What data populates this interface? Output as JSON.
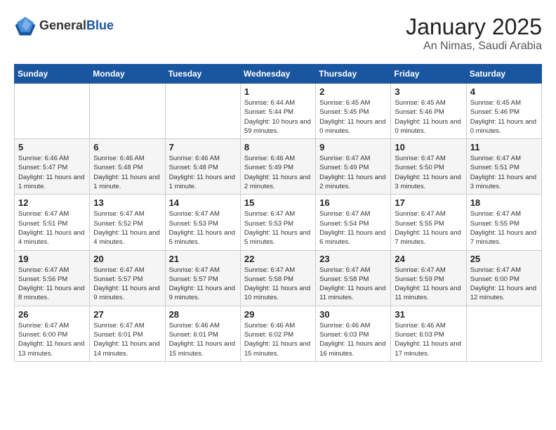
{
  "header": {
    "logo_general": "General",
    "logo_blue": "Blue",
    "month": "January 2025",
    "location": "An Nimas, Saudi Arabia"
  },
  "weekdays": [
    "Sunday",
    "Monday",
    "Tuesday",
    "Wednesday",
    "Thursday",
    "Friday",
    "Saturday"
  ],
  "weeks": [
    [
      {
        "day": "",
        "info": ""
      },
      {
        "day": "",
        "info": ""
      },
      {
        "day": "",
        "info": ""
      },
      {
        "day": "1",
        "info": "Sunrise: 6:44 AM\nSunset: 5:44 PM\nDaylight: 10 hours and 59 minutes."
      },
      {
        "day": "2",
        "info": "Sunrise: 6:45 AM\nSunset: 5:45 PM\nDaylight: 11 hours and 0 minutes."
      },
      {
        "day": "3",
        "info": "Sunrise: 6:45 AM\nSunset: 5:46 PM\nDaylight: 11 hours and 0 minutes."
      },
      {
        "day": "4",
        "info": "Sunrise: 6:45 AM\nSunset: 5:46 PM\nDaylight: 11 hours and 0 minutes."
      }
    ],
    [
      {
        "day": "5",
        "info": "Sunrise: 6:46 AM\nSunset: 5:47 PM\nDaylight: 11 hours and 1 minute."
      },
      {
        "day": "6",
        "info": "Sunrise: 6:46 AM\nSunset: 5:48 PM\nDaylight: 11 hours and 1 minute."
      },
      {
        "day": "7",
        "info": "Sunrise: 6:46 AM\nSunset: 5:48 PM\nDaylight: 11 hours and 1 minute."
      },
      {
        "day": "8",
        "info": "Sunrise: 6:46 AM\nSunset: 5:49 PM\nDaylight: 11 hours and 2 minutes."
      },
      {
        "day": "9",
        "info": "Sunrise: 6:47 AM\nSunset: 5:49 PM\nDaylight: 11 hours and 2 minutes."
      },
      {
        "day": "10",
        "info": "Sunrise: 6:47 AM\nSunset: 5:50 PM\nDaylight: 11 hours and 3 minutes."
      },
      {
        "day": "11",
        "info": "Sunrise: 6:47 AM\nSunset: 5:51 PM\nDaylight: 11 hours and 3 minutes."
      }
    ],
    [
      {
        "day": "12",
        "info": "Sunrise: 6:47 AM\nSunset: 5:51 PM\nDaylight: 11 hours and 4 minutes."
      },
      {
        "day": "13",
        "info": "Sunrise: 6:47 AM\nSunset: 5:52 PM\nDaylight: 11 hours and 4 minutes."
      },
      {
        "day": "14",
        "info": "Sunrise: 6:47 AM\nSunset: 5:53 PM\nDaylight: 11 hours and 5 minutes."
      },
      {
        "day": "15",
        "info": "Sunrise: 6:47 AM\nSunset: 5:53 PM\nDaylight: 11 hours and 5 minutes."
      },
      {
        "day": "16",
        "info": "Sunrise: 6:47 AM\nSunset: 5:54 PM\nDaylight: 11 hours and 6 minutes."
      },
      {
        "day": "17",
        "info": "Sunrise: 6:47 AM\nSunset: 5:55 PM\nDaylight: 11 hours and 7 minutes."
      },
      {
        "day": "18",
        "info": "Sunrise: 6:47 AM\nSunset: 5:55 PM\nDaylight: 11 hours and 7 minutes."
      }
    ],
    [
      {
        "day": "19",
        "info": "Sunrise: 6:47 AM\nSunset: 5:56 PM\nDaylight: 11 hours and 8 minutes."
      },
      {
        "day": "20",
        "info": "Sunrise: 6:47 AM\nSunset: 5:57 PM\nDaylight: 11 hours and 9 minutes."
      },
      {
        "day": "21",
        "info": "Sunrise: 6:47 AM\nSunset: 5:57 PM\nDaylight: 11 hours and 9 minutes."
      },
      {
        "day": "22",
        "info": "Sunrise: 6:47 AM\nSunset: 5:58 PM\nDaylight: 11 hours and 10 minutes."
      },
      {
        "day": "23",
        "info": "Sunrise: 6:47 AM\nSunset: 5:58 PM\nDaylight: 11 hours and 11 minutes."
      },
      {
        "day": "24",
        "info": "Sunrise: 6:47 AM\nSunset: 5:59 PM\nDaylight: 11 hours and 11 minutes."
      },
      {
        "day": "25",
        "info": "Sunrise: 6:47 AM\nSunset: 6:00 PM\nDaylight: 11 hours and 12 minutes."
      }
    ],
    [
      {
        "day": "26",
        "info": "Sunrise: 6:47 AM\nSunset: 6:00 PM\nDaylight: 11 hours and 13 minutes."
      },
      {
        "day": "27",
        "info": "Sunrise: 6:47 AM\nSunset: 6:01 PM\nDaylight: 11 hours and 14 minutes."
      },
      {
        "day": "28",
        "info": "Sunrise: 6:46 AM\nSunset: 6:01 PM\nDaylight: 11 hours and 15 minutes."
      },
      {
        "day": "29",
        "info": "Sunrise: 6:46 AM\nSunset: 6:02 PM\nDaylight: 11 hours and 15 minutes."
      },
      {
        "day": "30",
        "info": "Sunrise: 6:46 AM\nSunset: 6:03 PM\nDaylight: 11 hours and 16 minutes."
      },
      {
        "day": "31",
        "info": "Sunrise: 6:46 AM\nSunset: 6:03 PM\nDaylight: 11 hours and 17 minutes."
      },
      {
        "day": "",
        "info": ""
      }
    ]
  ]
}
